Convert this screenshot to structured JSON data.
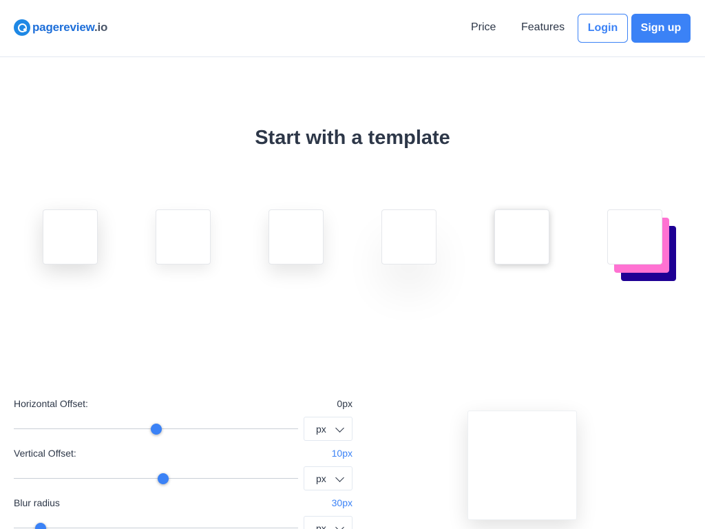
{
  "brand": {
    "name": "pagereview",
    "tld": ".io",
    "icon": "magnifier-logo-icon",
    "color": "#1e6fd9"
  },
  "nav": {
    "price": "Price",
    "features": "Features",
    "login": "Login",
    "signup": "Sign up"
  },
  "title": "Start with a template",
  "templates": [
    {
      "name": "template-1"
    },
    {
      "name": "template-2"
    },
    {
      "name": "template-3"
    },
    {
      "name": "template-4"
    },
    {
      "name": "template-5"
    },
    {
      "name": "template-6",
      "layer_colors": [
        "#ff72d2",
        "#1e0094"
      ]
    }
  ],
  "controls": {
    "horizontal": {
      "label": "Horizontal Offset:",
      "value": "0px",
      "unit": "px",
      "level": 0.5
    },
    "vertical": {
      "label": "Vertical Offset:",
      "value": "10px",
      "unit": "px",
      "level": 0.525
    },
    "blur": {
      "label": "Blur radius",
      "value": "30px",
      "unit": "px",
      "level": 0.095
    }
  },
  "colors": {
    "accent": "#3b82f6",
    "text": "#2d3748"
  }
}
